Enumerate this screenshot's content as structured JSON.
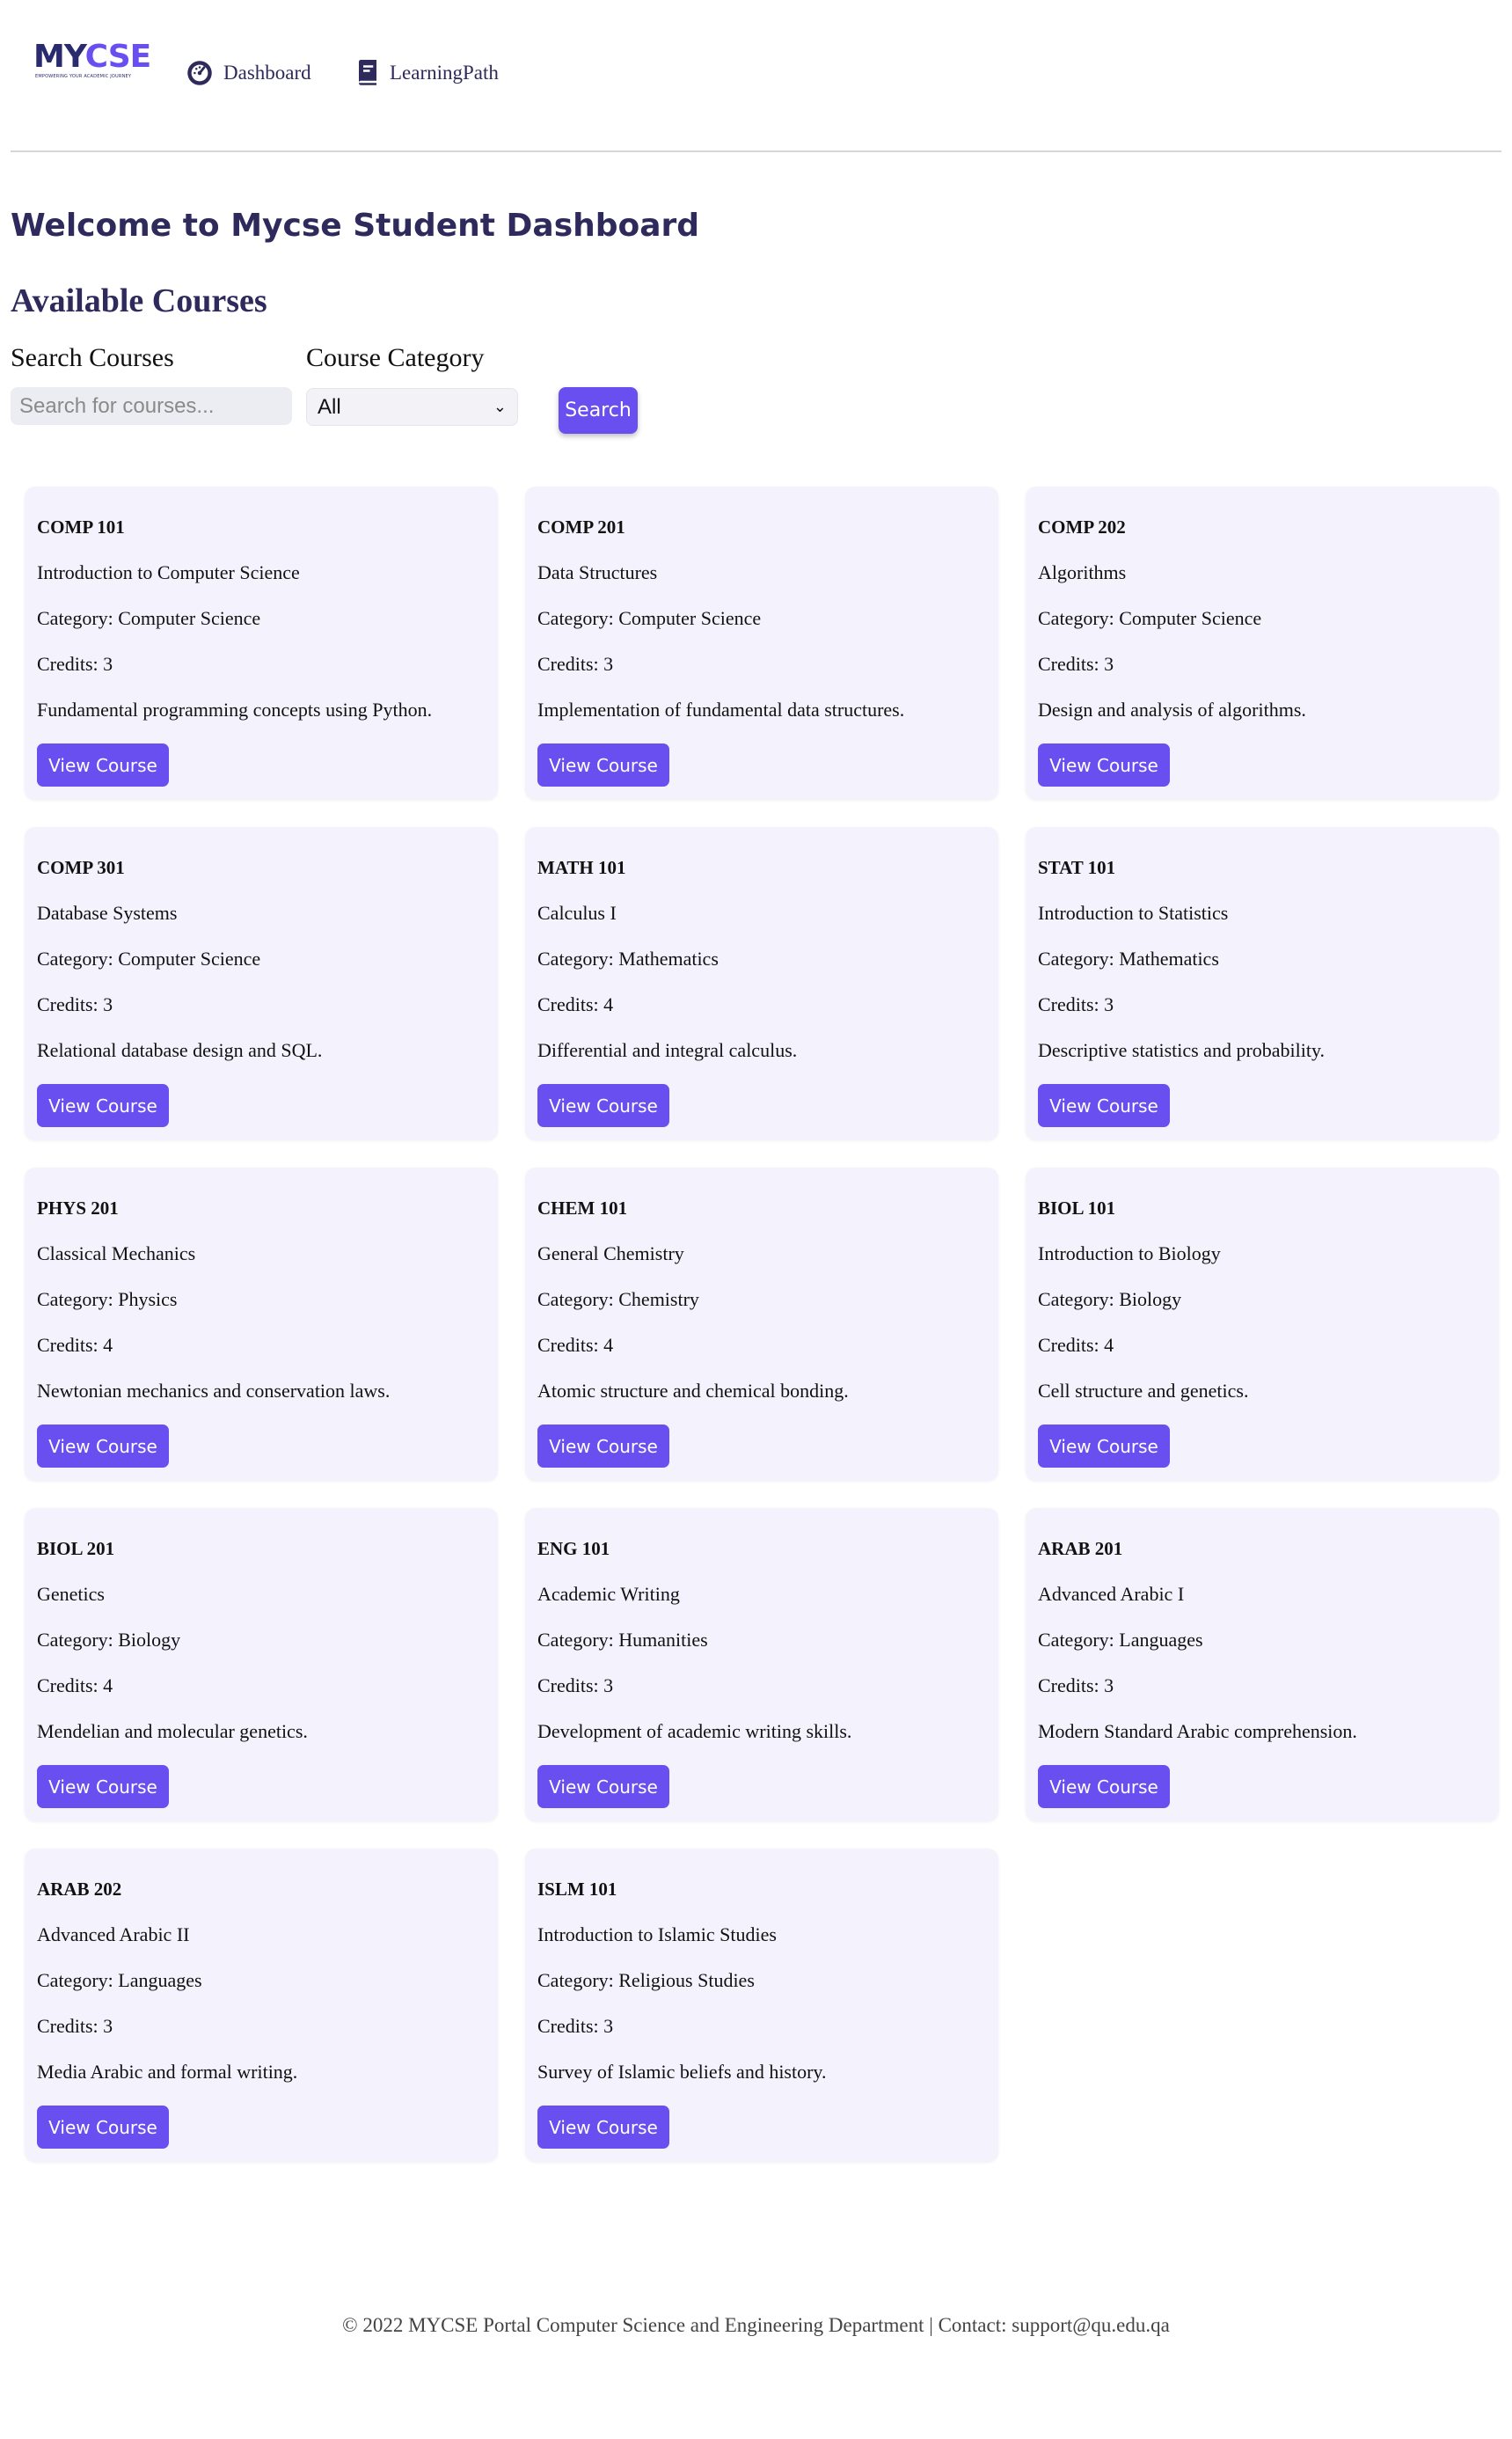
{
  "brand": {
    "logo_primary": "MY",
    "logo_accent": "CSE",
    "logo_tagline": "EMPOWERING YOUR ACADEMIC JOURNEY"
  },
  "nav": {
    "dashboard": "Dashboard",
    "learning_path": "LearningPath"
  },
  "page": {
    "title": "Welcome to Mycse Student Dashboard",
    "section": "Available Courses"
  },
  "filters": {
    "search_label": "Search Courses",
    "search_placeholder": "Search for courses...",
    "category_label": "Course Category",
    "category_value": "All",
    "search_button": "Search"
  },
  "courses": [
    {
      "code": "COMP 101",
      "name": "Introduction to Computer Science",
      "category": "Category: Computer Science",
      "credits": "Credits: 3",
      "description": "Fundamental programming concepts using Python.",
      "button": "View Course"
    },
    {
      "code": "COMP 201",
      "name": "Data Structures",
      "category": "Category: Computer Science",
      "credits": "Credits: 3",
      "description": "Implementation of fundamental data structures.",
      "button": "View Course"
    },
    {
      "code": "COMP 202",
      "name": "Algorithms",
      "category": "Category: Computer Science",
      "credits": "Credits: 3",
      "description": "Design and analysis of algorithms.",
      "button": "View Course"
    },
    {
      "code": "COMP 301",
      "name": "Database Systems",
      "category": "Category: Computer Science",
      "credits": "Credits: 3",
      "description": "Relational database design and SQL.",
      "button": "View Course"
    },
    {
      "code": "MATH 101",
      "name": "Calculus I",
      "category": "Category: Mathematics",
      "credits": "Credits: 4",
      "description": "Differential and integral calculus.",
      "button": "View Course"
    },
    {
      "code": "STAT 101",
      "name": "Introduction to Statistics",
      "category": "Category: Mathematics",
      "credits": "Credits: 3",
      "description": "Descriptive statistics and probability.",
      "button": "View Course"
    },
    {
      "code": "PHYS 201",
      "name": "Classical Mechanics",
      "category": "Category: Physics",
      "credits": "Credits: 4",
      "description": "Newtonian mechanics and conservation laws.",
      "button": "View Course"
    },
    {
      "code": "CHEM 101",
      "name": "General Chemistry",
      "category": "Category: Chemistry",
      "credits": "Credits: 4",
      "description": "Atomic structure and chemical bonding.",
      "button": "View Course"
    },
    {
      "code": "BIOL 101",
      "name": "Introduction to Biology",
      "category": "Category: Biology",
      "credits": "Credits: 4",
      "description": "Cell structure and genetics.",
      "button": "View Course"
    },
    {
      "code": "BIOL 201",
      "name": "Genetics",
      "category": "Category: Biology",
      "credits": "Credits: 4",
      "description": "Mendelian and molecular genetics.",
      "button": "View Course"
    },
    {
      "code": "ENG 101",
      "name": "Academic Writing",
      "category": "Category: Humanities",
      "credits": "Credits: 3",
      "description": "Development of academic writing skills.",
      "button": "View Course"
    },
    {
      "code": "ARAB 201",
      "name": "Advanced Arabic I",
      "category": "Category: Languages",
      "credits": "Credits: 3",
      "description": "Modern Standard Arabic comprehension.",
      "button": "View Course"
    },
    {
      "code": "ARAB 202",
      "name": "Advanced Arabic II",
      "category": "Category: Languages",
      "credits": "Credits: 3",
      "description": "Media Arabic and formal writing.",
      "button": "View Course"
    },
    {
      "code": "ISLM 101",
      "name": "Introduction to Islamic Studies",
      "category": "Category: Religious Studies",
      "credits": "Credits: 3",
      "description": "Survey of Islamic beliefs and history.",
      "button": "View Course"
    }
  ],
  "footer": {
    "text": "© 2022 MYCSE Portal Computer Science and Engineering Department | Contact: support@qu.edu.qa"
  },
  "colors": {
    "accent": "#6a4ff0",
    "heading": "#2e2a5c",
    "card_bg": "#f4f3fd"
  },
  "icons": {
    "dashboard": "gauge-icon",
    "learning_path": "book-icon",
    "select": "chevron-down-icon"
  }
}
